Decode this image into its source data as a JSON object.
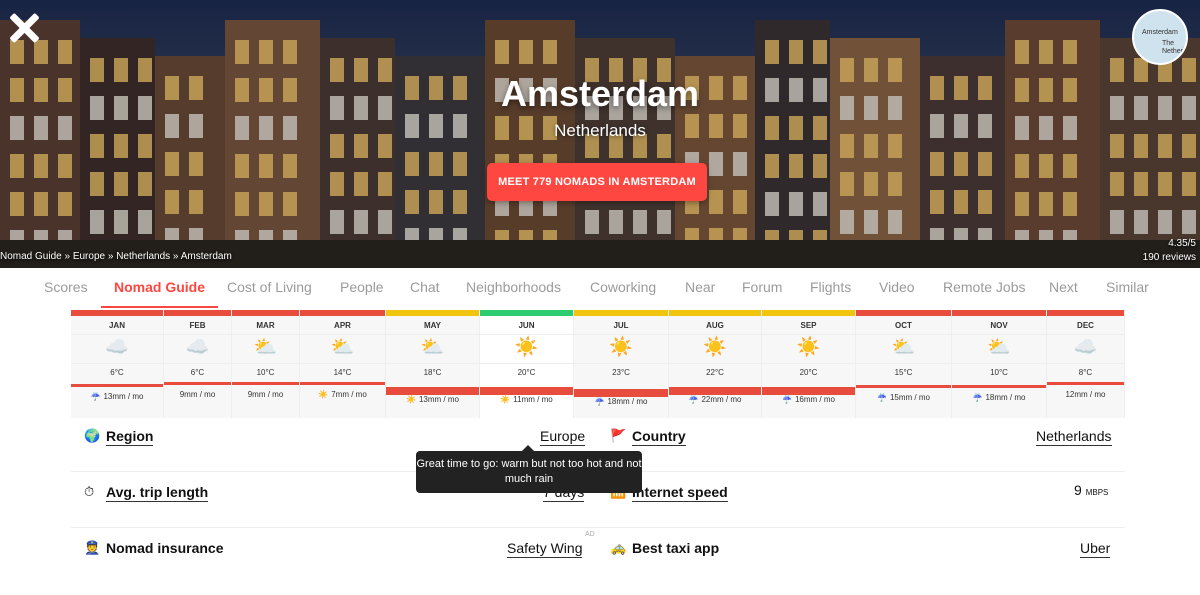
{
  "hero": {
    "city": "Amsterdam",
    "country": "Netherlands",
    "cta": "MEET 779 NOMADS IN AMSTERDAM",
    "breadcrumb": [
      "Nomad Guide",
      "Europe",
      "Netherlands",
      "Amsterdam"
    ],
    "rating": "4.35/5",
    "reviews": "190 reviews",
    "map_label_1": "Amsterdam",
    "map_label_2": "The Netherl"
  },
  "tabs": [
    "Scores",
    "Nomad Guide",
    "Cost of Living",
    "People",
    "Chat",
    "Neighborhoods",
    "Coworking",
    "Near",
    "Forum",
    "Flights",
    "Video",
    "Remote Jobs",
    "Next",
    "Similar"
  ],
  "active_tab": "Nomad Guide",
  "climate": [
    {
      "month": "JAN",
      "icon": "cloud-icon",
      "temp": "6°C",
      "rain": "13mm / mo",
      "rain_icon": "rain-icon",
      "status": "bad"
    },
    {
      "month": "FEB",
      "icon": "cloud-icon",
      "temp": "6°C",
      "rain": "9mm / mo",
      "rain_icon": "",
      "status": "bad"
    },
    {
      "month": "MAR",
      "icon": "partly-sunny-icon",
      "temp": "10°C",
      "rain": "9mm / mo",
      "rain_icon": "",
      "status": "bad"
    },
    {
      "month": "APR",
      "icon": "partly-sunny-icon",
      "temp": "14°C",
      "rain": "7mm / mo",
      "rain_icon": "sun-icon",
      "status": "bad"
    },
    {
      "month": "MAY",
      "icon": "partly-sunny-icon",
      "temp": "18°C",
      "rain": "13mm / mo",
      "rain_icon": "sun-icon",
      "status": "okay"
    },
    {
      "month": "JUN",
      "icon": "sun-icon",
      "temp": "20°C",
      "rain": "11mm / mo",
      "rain_icon": "sun-icon",
      "status": "good"
    },
    {
      "month": "JUL",
      "icon": "sun-icon",
      "temp": "23°C",
      "rain": "18mm / mo",
      "rain_icon": "rain-icon",
      "status": "okay"
    },
    {
      "month": "AUG",
      "icon": "sun-icon",
      "temp": "22°C",
      "rain": "22mm / mo",
      "rain_icon": "rain-icon",
      "status": "okay"
    },
    {
      "month": "SEP",
      "icon": "sun-icon",
      "temp": "20°C",
      "rain": "16mm / mo",
      "rain_icon": "rain-icon",
      "status": "okay"
    },
    {
      "month": "OCT",
      "icon": "partly-sunny-icon",
      "temp": "15°C",
      "rain": "15mm / mo",
      "rain_icon": "rain-icon",
      "status": "bad"
    },
    {
      "month": "NOV",
      "icon": "partly-sunny-icon",
      "temp": "10°C",
      "rain": "18mm / mo",
      "rain_icon": "rain-icon",
      "status": "bad"
    },
    {
      "month": "DEC",
      "icon": "cloud-icon",
      "temp": "8°C",
      "rain": "12mm / mo",
      "rain_icon": "",
      "status": "bad"
    }
  ],
  "status_colors": {
    "bad": "#e74c3c",
    "okay": "#f1c40f",
    "good": "#2ecc71"
  },
  "rows": {
    "region_label": "Region",
    "region_value": "Europe",
    "country_label": "Country",
    "country_value": "Netherlands",
    "trip_label": "Avg. trip length",
    "trip_value": "7 days",
    "internet_label": "Internet speed",
    "internet_value": "9",
    "internet_unit": "MBPS",
    "insurance_label": "Nomad insurance",
    "insurance_value": "Safety Wing",
    "taxi_label": "Best taxi app",
    "taxi_value": "Uber",
    "ad_label": "AD"
  },
  "tooltip": "Great time to go: warm but not too hot and not much rain"
}
